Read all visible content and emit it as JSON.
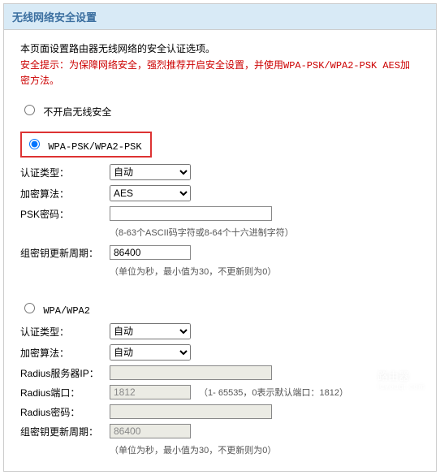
{
  "panel": {
    "title": "无线网络安全设置",
    "description": "本页面设置路由器无线网络的安全认证选项。",
    "warning": "安全提示：为保障网络安全，强烈推荐开启安全设置，并使用WPA-PSK/WPA2-PSK AES加密方法。"
  },
  "security_mode": {
    "disable_label": "不开启无线安全",
    "psk_label": "WPA-PSK/WPA2-PSK",
    "wpa_label": "WPA/WPA2",
    "selected": "psk"
  },
  "psk": {
    "auth_label": "认证类型：",
    "auth_value": "自动",
    "enc_label": "加密算法：",
    "enc_value": "AES",
    "pwd_label": "PSK密码：",
    "pwd_value": "",
    "pwd_hint": "（8-63个ASCII码字符或8-64个十六进制字符）",
    "gk_label": "组密钥更新周期：",
    "gk_value": "86400",
    "gk_hint": "（单位为秒，最小值为30，不更新则为0）"
  },
  "wpa": {
    "auth_label": "认证类型：",
    "auth_value": "自动",
    "enc_label": "加密算法：",
    "enc_value": "自动",
    "radius_ip_label": "Radius服务器IP：",
    "radius_ip_value": "",
    "radius_port_label": "Radius端口：",
    "radius_port_value": "1812",
    "radius_port_hint": "（1- 65535，0表示默认端口：1812）",
    "radius_pwd_label": "Radius密码：",
    "radius_pwd_value": "",
    "gk_label": "组密钥更新周期：",
    "gk_value": "86400",
    "gk_hint": "（单位为秒，最小值为30，不更新则为0）"
  },
  "watermark": {
    "title": "路由器",
    "sub": "luyouqi.com"
  }
}
